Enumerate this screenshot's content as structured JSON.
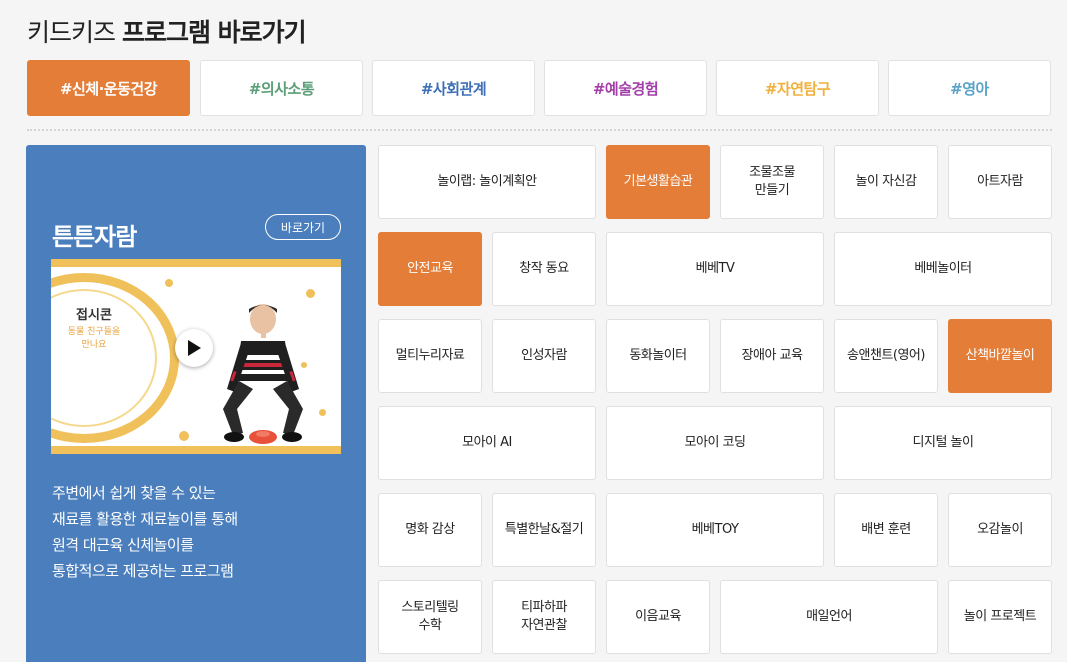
{
  "page": {
    "title_light": "키드키즈",
    "title_bold": "프로그램 바로가기"
  },
  "tabs": [
    {
      "label": "#신체·운동건강",
      "color": "#ffffff",
      "active": true
    },
    {
      "label": "#의사소통",
      "color": "#5c9e77",
      "active": false
    },
    {
      "label": "#사회관계",
      "color": "#3f6fb5",
      "active": false
    },
    {
      "label": "#예술경험",
      "color": "#a23fa8",
      "active": false
    },
    {
      "label": "#자연탐구",
      "color": "#f0b03c",
      "active": false
    },
    {
      "label": "#영아",
      "color": "#5aa2c8",
      "active": false
    }
  ],
  "feature": {
    "name": "튼튼자람",
    "goto_label": "바로가기",
    "video_title": "접시콘",
    "video_subtitle_1": "동물 친구들을",
    "video_subtitle_2": "만나요",
    "description": [
      "주변에서 쉽게 찾을 수 있는",
      "재료를 활용한 재료놀이를 통해",
      "원격 대근육 신체놀이를",
      "통합적으로 제공하는 프로그램"
    ],
    "colors": {
      "panel": "#4a7ebd",
      "accent": "#f0c15b"
    }
  },
  "programs": [
    {
      "label": "놀이랩: 놀이계획안",
      "active": false
    },
    {
      "label": "기본생활습관",
      "active": true
    },
    {
      "label": "조물조물\n만들기",
      "active": false
    },
    {
      "label": "놀이 자신감",
      "active": false
    },
    {
      "label": "아트자람",
      "active": false
    },
    {
      "label": "안전교육",
      "active": true
    },
    {
      "label": "창작 동요",
      "active": false
    },
    {
      "label": "베베TV",
      "active": false
    },
    {
      "label": "베베놀이터",
      "active": false
    },
    {
      "label": "멀티누리자료",
      "active": false
    },
    {
      "label": "인성자람",
      "active": false
    },
    {
      "label": "동화놀이터",
      "active": false
    },
    {
      "label": "장애아 교육",
      "active": false
    },
    {
      "label": "송앤챈트(영어)",
      "active": false
    },
    {
      "label": "산책바깥놀이",
      "active": true
    },
    {
      "label": "모아이 AI",
      "active": false
    },
    {
      "label": "모아이 코딩",
      "active": false
    },
    {
      "label": "디지털 놀이",
      "active": false
    },
    {
      "label": "명화 감상",
      "active": false
    },
    {
      "label": "특별한날&절기",
      "active": false
    },
    {
      "label": "베베TOY",
      "active": false
    },
    {
      "label": "배변 훈련",
      "active": false
    },
    {
      "label": "오감놀이",
      "active": false
    },
    {
      "label": "스토리텔링\n수학",
      "active": false
    },
    {
      "label": "티파하파\n자연관찰",
      "active": false
    },
    {
      "label": "이음교육",
      "active": false
    },
    {
      "label": "매일언어",
      "active": false
    },
    {
      "label": "놀이 프로젝트",
      "active": false
    }
  ],
  "colors": {
    "accent": "#e37d37",
    "background": "#f5f5f5"
  }
}
